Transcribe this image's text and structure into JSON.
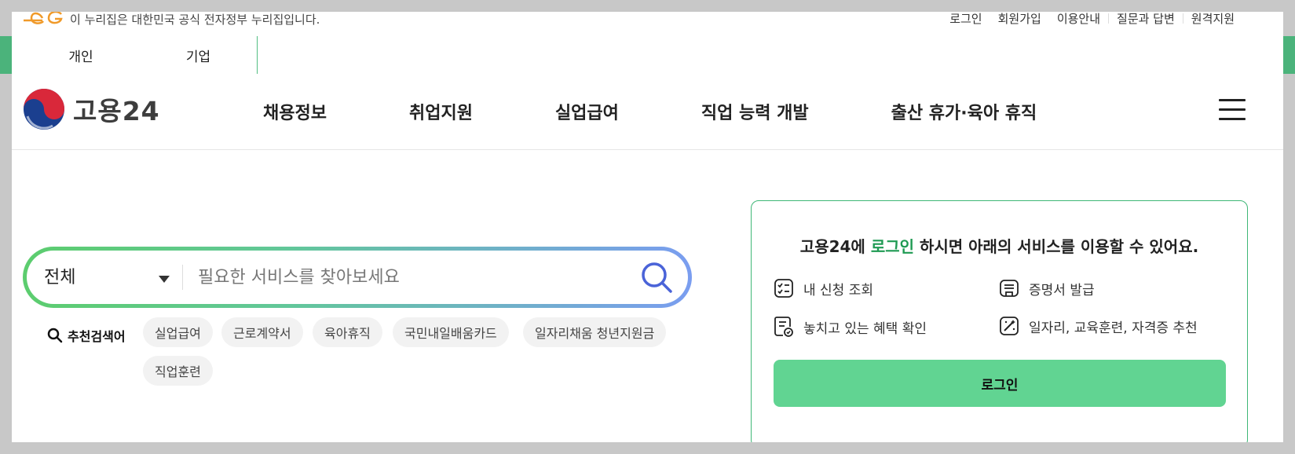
{
  "gov_banner": {
    "text": "이 누리집은 대한민국 공식 전자정부 누리집입니다."
  },
  "util_links": [
    "로그인",
    "회원가입",
    "이용안내",
    "질문과 답변",
    "원격지원"
  ],
  "tabs": [
    {
      "label": "개인",
      "active": true
    },
    {
      "label": "기업",
      "active": false
    }
  ],
  "brand": {
    "name": "고용24"
  },
  "gnb": [
    "채용정보",
    "취업지원",
    "실업급여",
    "직업 능력 개발",
    "출산 휴가·육아 휴직"
  ],
  "search": {
    "scope": "전체",
    "placeholder": "필요한 서비스를 찾아보세요",
    "value": ""
  },
  "recommended": {
    "label": "추천검색어",
    "keywords": [
      "실업급여",
      "근로계약서",
      "육아휴직",
      "국민내일배움카드",
      "일자리채움 청년지원금",
      "직업훈련"
    ]
  },
  "login_card": {
    "title_prefix": "고용24에",
    "title_highlight": "로그인",
    "title_suffix": "하시면 아래의 서비스를 이용할 수 있어요.",
    "services": [
      {
        "label": "내 신청 조회",
        "icon": "checklist-icon"
      },
      {
        "label": "증명서 발급",
        "icon": "certificate-icon"
      },
      {
        "label": "놓치고 있는 혜택 확인",
        "icon": "benefit-document-icon"
      },
      {
        "label": "일자리, 교육훈련, 자격증 추천",
        "icon": "magic-wand-icon"
      }
    ],
    "button_label": "로그인"
  },
  "colors": {
    "brand_green": "#61d492",
    "highlight_green": "#1f9a53",
    "card_border": "#3fb777",
    "search_gradient_start": "#5ccd6e",
    "search_gradient_end": "#7a9df0"
  }
}
